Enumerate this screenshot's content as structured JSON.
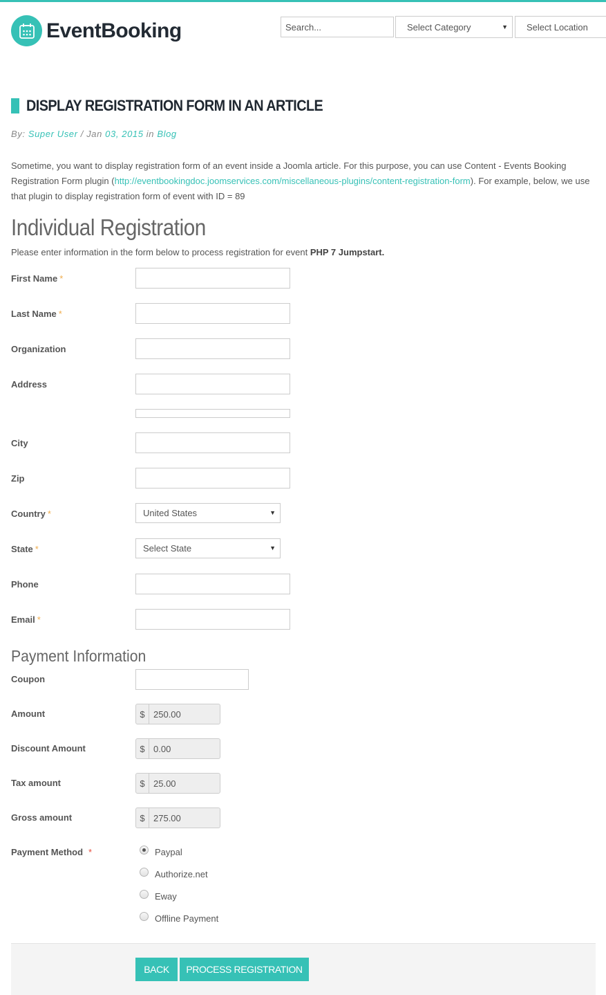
{
  "header": {
    "brand": "EventBooking",
    "logo_icon": "calendar-icon",
    "search_placeholder": "Search...",
    "category_select": "Select Category",
    "location_select": "Select Location"
  },
  "article": {
    "title": "DISPLAY REGISTRATION FORM IN AN ARTICLE",
    "meta": {
      "by_label": "By:",
      "author": "Super User",
      "separator": " / Jan ",
      "date": "03, 2015",
      "in_label": " in ",
      "category": "Blog"
    },
    "intro_before_link": "Sometime, you want to display registration form of an event inside a Joomla article. For this purpose, you can use Content - Events Booking Registration Form plugin (",
    "intro_link": "http://eventbookingdoc.joomservices.com/miscellaneous-plugins/content-registration-form",
    "intro_after_link": "). For example, below, we use that plugin to display registration form of event with ID = 89"
  },
  "form": {
    "title": "Individual Registration",
    "description_prefix": "Please enter information in the form below to process registration for event ",
    "event_name": "PHP 7 Jumpstart.",
    "fields": {
      "first_name": {
        "label": "First Name",
        "required": "*",
        "value": ""
      },
      "last_name": {
        "label": "Last Name",
        "required": "*",
        "value": ""
      },
      "organization": {
        "label": "Organization",
        "value": ""
      },
      "address": {
        "label": "Address",
        "value": ""
      },
      "address2": {
        "value": ""
      },
      "city": {
        "label": "City",
        "value": ""
      },
      "zip": {
        "label": "Zip",
        "value": ""
      },
      "country": {
        "label": "Country",
        "required": "*",
        "value": "United States"
      },
      "state": {
        "label": "State",
        "required": "*",
        "value": "Select State"
      },
      "phone": {
        "label": "Phone",
        "value": ""
      },
      "email": {
        "label": "Email",
        "required": "*",
        "value": ""
      }
    },
    "payment": {
      "title": "Payment Information",
      "currency": "$",
      "coupon": {
        "label": "Coupon",
        "value": ""
      },
      "amount": {
        "label": "Amount",
        "value": "250.00"
      },
      "discount": {
        "label": "Discount Amount",
        "value": "0.00"
      },
      "tax": {
        "label": "Tax amount",
        "value": "25.00"
      },
      "gross": {
        "label": "Gross amount",
        "value": "275.00"
      },
      "method": {
        "label": "Payment Method",
        "required": "*",
        "options": [
          "Paypal",
          "Authorize.net",
          "Eway",
          "Offline Payment"
        ],
        "selected": "Paypal"
      }
    },
    "buttons": {
      "back": "BACK",
      "process": "PROCESS REGISTRATION"
    }
  }
}
